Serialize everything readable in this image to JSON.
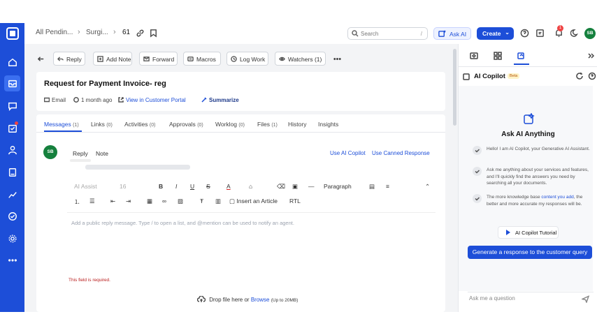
{
  "topbar": {
    "crumbs": [
      "All Pendin...",
      "Surgi...",
      "61"
    ],
    "search_placeholder": "Search",
    "search_shortcut": "/",
    "ask_ai": "Ask AI",
    "create": "Create",
    "notif_count": "1",
    "user_initials": "SB"
  },
  "actions": {
    "reply": "Reply",
    "add_note": "Add Note",
    "forward": "Forward",
    "macros": "Macros",
    "log_work": "Log Work",
    "watchers": "Watchers (1)"
  },
  "ticket": {
    "title": "Request for Payment Invoice- reg",
    "channel": "Email",
    "time": "1 month ago",
    "portal_link": "View in Customer Portal",
    "summarize": "Summarize"
  },
  "tabs": [
    {
      "label": "Messages",
      "count": "(1)"
    },
    {
      "label": "Links",
      "count": "(0)"
    },
    {
      "label": "Activities",
      "count": "(0)"
    },
    {
      "label": "Approvals",
      "count": "(0)"
    },
    {
      "label": "Worklog",
      "count": "(0)"
    },
    {
      "label": "Files",
      "count": "(1)"
    },
    {
      "label": "History",
      "count": ""
    },
    {
      "label": "Insights",
      "count": ""
    }
  ],
  "composer": {
    "sender_initials": "SB",
    "reply_tab": "Reply",
    "note_tab": "Note",
    "use_ai_copilot": "Use AI Copilot",
    "use_canned": "Use Canned Response",
    "font": "AI Assist",
    "font_size": "16",
    "paragraph": "Paragraph",
    "insert_article": "Insert an Article",
    "rtl": "RTL",
    "placeholder": "Add a public reply message. Type / to open a list, and @mention can be used to notify an agent.",
    "error": "This field is required.",
    "drop_text": "Drop file here or",
    "browse": "Browse",
    "size_limit": "(Up to 20MB)"
  },
  "copilot": {
    "title": "AI Copilot",
    "badge": "Beta",
    "heading": "Ask AI Anything",
    "tips": [
      "Hello! I am AI Copilot, your Generative AI Assistant.",
      "Ask me anything about your services and features, and I'll quickly find the answers you need by searching all your documents.",
      "The more knowledge base"
    ],
    "tip3_link": "content you add",
    "tip3_tail": ", the better and more accurate my responses will be.",
    "tutorial": "AI Copilot Tutorial",
    "generate": "Generate a response to the customer query",
    "ask_placeholder": "Ask me a question"
  }
}
